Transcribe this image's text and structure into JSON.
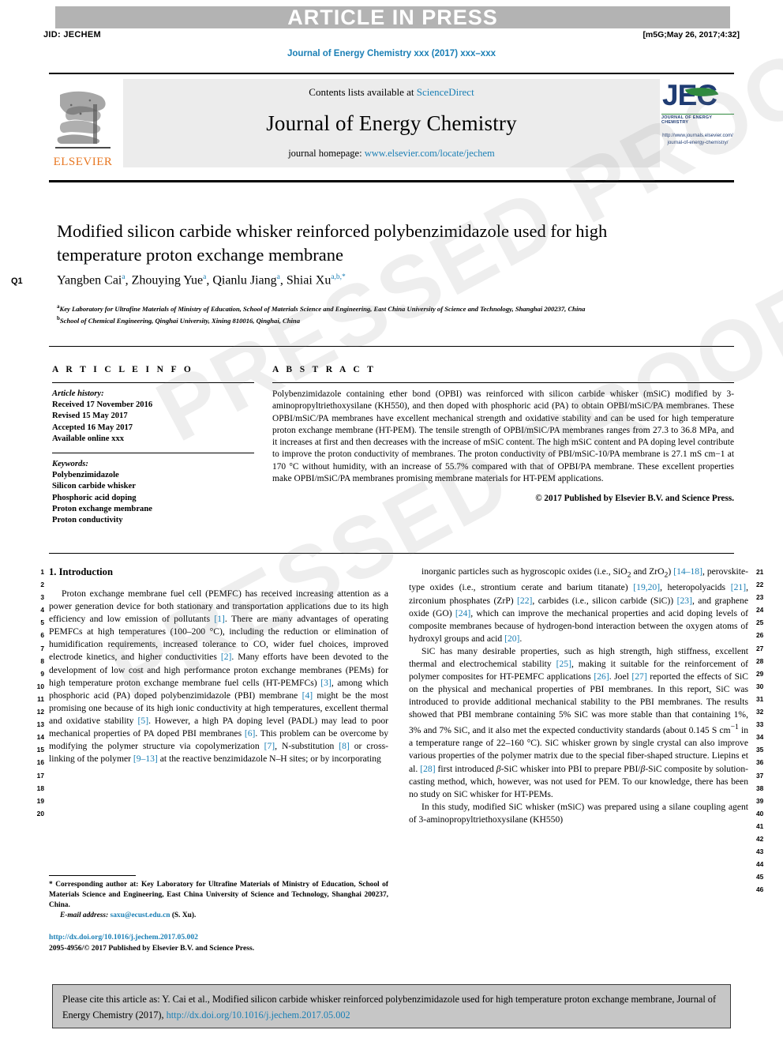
{
  "header": {
    "banner": "ARTICLE IN PRESS",
    "jid": "JID: JECHEM",
    "stamp": "[m5G;May 26, 2017;4:32]",
    "running_head": "Journal of Energy Chemistry xxx (2017) xxx–xxx"
  },
  "masthead": {
    "contents_prefix": "Contents lists available at ",
    "contents_link": "ScienceDirect",
    "journal_name": "Journal of Energy Chemistry",
    "homepage_prefix": "journal homepage: ",
    "homepage_link": "www.elsevier.com/locate/jechem",
    "elsevier_wordmark": "ELSEVIER",
    "jec_letters": "JEC",
    "jec_subtitle": "JOURNAL OF ENERGY CHEMISTRY",
    "jec_url_line1": "http://www.journals.elsevier.com/",
    "jec_url_line2": "journal-of-energy-chemistry/"
  },
  "article": {
    "query_marker": "Q1",
    "title": "Modified silicon carbide whisker reinforced polybenzimidazole used for high temperature proton exchange membrane",
    "authors": [
      {
        "name": "Yangben Cai",
        "sup": "a"
      },
      {
        "name": "Zhouying Yue",
        "sup": "a"
      },
      {
        "name": "Qianlu Jiang",
        "sup": "a"
      },
      {
        "name": "Shiai Xu",
        "sup": "a,b,*"
      }
    ],
    "affiliations": [
      {
        "marker": "a",
        "text": "Key Laboratory for Ultrafine Materials of Ministry of Education, School of Materials Science and Engineering, East China University of Science and Technology, Shanghai 200237, China"
      },
      {
        "marker": "b",
        "text": "School of Chemical Engineering, Qinghai University, Xining 810016, Qinghai, China"
      }
    ]
  },
  "article_info": {
    "heading": "A R T I C L E    I N F O",
    "history_label": "Article history:",
    "history": [
      "Received 17 November 2016",
      "Revised 15 May 2017",
      "Accepted 16 May 2017",
      "Available online xxx"
    ],
    "keywords_label": "Keywords:",
    "keywords": [
      "Polybenzimidazole",
      "Silicon carbide whisker",
      "Phosphoric acid doping",
      "Proton exchange membrane",
      "Proton conductivity"
    ]
  },
  "abstract": {
    "heading": "A B S T R A C T",
    "text": "Polybenzimidazole containing ether bond (OPBI) was reinforced with silicon carbide whisker (mSiC) modified by 3-aminopropyltriethoxysilane (KH550), and then doped with phosphoric acid (PA) to obtain OPBI/mSiC/PA membranes. These OPBI/mSiC/PA membranes have excellent mechanical strength and oxidative stability and can be used for high temperature proton exchange membrane (HT-PEM). The tensile strength of OPBI/mSiC/PA membranes ranges from 27.3 to 36.8 MPa, and it increases at first and then decreases with the increase of mSiC content. The high mSiC content and PA doping level contribute to improve the proton conductivity of membranes. The proton conductivity of PBI/mSiC-10/PA membrane is 27.1 mS cm−1 at 170 °C without humidity, with an increase of 55.7% compared with that of OPBI/PA membrane. These excellent properties make OPBI/mSiC/PA membranes promising membrane materials for HT-PEM applications.",
    "copyright": "© 2017 Published by Elsevier B.V. and Science Press."
  },
  "body": {
    "section_heading": "1. Introduction",
    "left_column_paragraphs": [
      "Proton exchange membrane fuel cell (PEMFC) has received increasing attention as a power generation device for both stationary and transportation applications due to its high efficiency and low emission of pollutants [1]. There are many advantages of operating PEMFCs at high temperatures (100–200 °C), including the reduction or elimination of humidification requirements, increased tolerance to CO, wider fuel choices, improved electrode kinetics, and higher conductivities [2]. Many efforts have been devoted to the development of low cost and high performance proton exchange membranes (PEMs) for high temperature proton exchange membrane fuel cells (HT-PEMFCs) [3], among which phosphoric acid (PA) doped polybenzimidazole (PBI) membrane [4] might be the most promising one because of its high ionic conductivity at high temperatures, excellent thermal and oxidative stability [5]. However, a high PA doping level (PADL) may lead to poor mechanical properties of PA doped PBI membranes [6]. This problem can be overcome by modifying the polymer structure via copolymerization [7], N-substitution [8] or cross-linking of the polymer [9–13] at the reactive benzimidazole N–H sites; or by incorporating"
    ],
    "right_column_paragraphs": [
      "inorganic particles such as hygroscopic oxides (i.e., SiO2 and ZrO2) [14–18], perovskite-type oxides (i.e., strontium cerate and barium titanate) [19,20], heteropolyacids [21], zirconium phosphates (ZrP) [22], carbides (i.e., silicon carbide (SiC)) [23], and graphene oxide (GO) [24], which can improve the mechanical properties and acid doping levels of composite membranes because of hydrogen-bond interaction between the oxygen atoms of hydroxyl groups and acid [20].",
      "SiC has many desirable properties, such as high strength, high stiffness, excellent thermal and electrochemical stability [25], making it suitable for the reinforcement of polymer composites for HT-PEMFC applications [26]. Joel [27] reported the effects of SiC on the physical and mechanical properties of PBI membranes. In this report, SiC was introduced to provide additional mechanical stability to the PBI membranes. The results showed that PBI membrane containing 5% SiC was more stable than that containing 1%, 3% and 7% SiC, and it also met the expected conductivity standards (about 0.145 S cm−1 in a temperature range of 22–160 °C). SiC whisker grown by single crystal can also improve various properties of the polymer matrix due to the special fiber-shaped structure. Liepins et al. [28] first introduced β-SiC whisker into PBI to prepare PBI/β-SiC composite by solution-casting method, which, however, was not used for PEM. To our knowledge, there has been no study on SiC whisker for HT-PEMs.",
      "In this study, modified SiC whisker (mSiC) was prepared using a silane coupling agent of 3-aminopropyltriethoxysilane (KH550)"
    ],
    "left_line_numbers": [
      "1",
      "2",
      "3",
      "4",
      "5",
      "6",
      "7",
      "8",
      "9",
      "10",
      "11",
      "12",
      "13",
      "14",
      "15",
      "16",
      "17",
      "18",
      "19",
      "20"
    ],
    "right_line_numbers": [
      "21",
      "22",
      "23",
      "24",
      "25",
      "26",
      "27",
      "28",
      "29",
      "30",
      "31",
      "32",
      "33",
      "34",
      "35",
      "36",
      "37",
      "38",
      "39",
      "40",
      "41",
      "42",
      "43",
      "44",
      "45",
      "46"
    ]
  },
  "footnote": {
    "corresponding": "* Corresponding author at: Key Laboratory for Ultrafine Materials of Ministry of Education, School of Materials Science and Engineering, East China University of Science and Technology, Shanghai 200237, China.",
    "email_label": "E-mail address:",
    "email": "saxu@ecust.edu.cn",
    "email_owner": "(S. Xu).",
    "doi": "http://dx.doi.org/10.1016/j.jechem.2017.05.002",
    "issn_line": "2095-4956/© 2017 Published by Elsevier B.V. and Science Press."
  },
  "cite_box": {
    "text_before": "Please cite this article as: Y. Cai et al., Modified silicon carbide whisker reinforced polybenzimidazole used for high temperature proton exchange membrane, Journal of Energy Chemistry (2017), ",
    "link": "http://dx.doi.org/10.1016/j.jechem.2017.05.002"
  },
  "watermark": {
    "line1": "PRESSED PROOF",
    "line2": "PRESSED PROOF"
  },
  "colors": {
    "link": "#1a7fb5",
    "elsevier_orange": "#e87722",
    "jec_blue": "#1f3c73",
    "jec_green": "#2f8a3e",
    "banner_gray": "#b3b3b3",
    "cite_gray": "#c6c6c6"
  }
}
